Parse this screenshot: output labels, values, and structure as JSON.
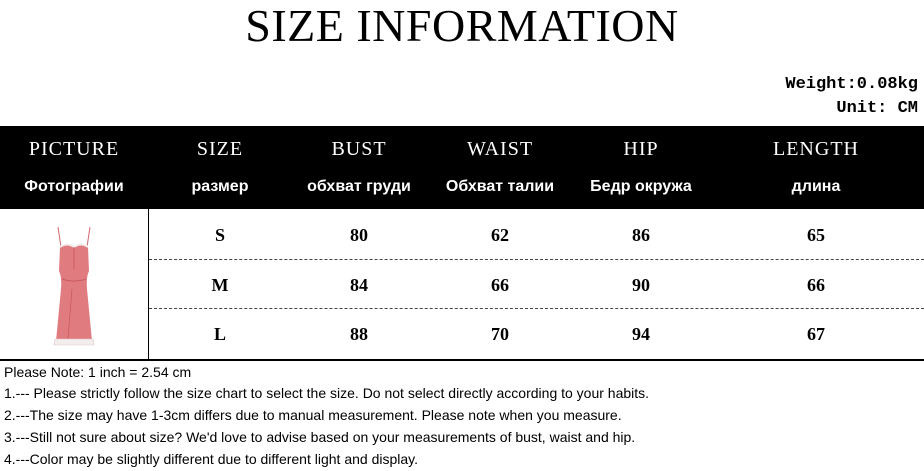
{
  "title": "SIZE INFORMATION",
  "weight": "Weight:0.08kg",
  "unit": "Unit: CM",
  "table": {
    "header_en": [
      "PICTURE",
      "SIZE",
      "BUST",
      "WAIST",
      "HIP",
      "LENGTH"
    ],
    "header_ru": [
      "Фотографии",
      "размер",
      "обхват груди",
      "Обхват талии",
      "Бедр окружа",
      "длина"
    ],
    "rows": [
      [
        "S",
        "80",
        "62",
        "86",
        "65"
      ],
      [
        "M",
        "84",
        "66",
        "90",
        "66"
      ],
      [
        "L",
        "88",
        "70",
        "94",
        "67"
      ]
    ]
  },
  "product_image": "pink-mini-dress",
  "colors": {
    "header_bg": "#000000",
    "dress": "#e07b80",
    "lace": "#f4eded"
  },
  "notes": [
    "Please Note: 1 inch = 2.54 cm",
    " 1.--- Please strictly follow the size chart to select the size. Do not select directly according to your habits.",
    "2.---The size may have 1-3cm differs due to manual measurement. Please note when you measure.",
    "3.---Still not sure about size? We'd love to advise based on your measurements of bust, waist and hip.",
    "4.---Color may be slightly different due to different light and display."
  ]
}
